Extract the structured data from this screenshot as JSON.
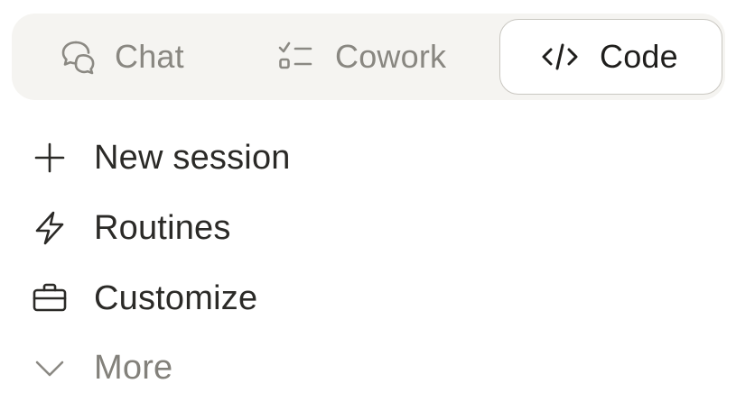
{
  "mode_switcher": {
    "tabs": [
      {
        "label": "Chat",
        "icon": "chat-bubbles-icon",
        "active": false
      },
      {
        "label": "Cowork",
        "icon": "checklist-icon",
        "active": false
      },
      {
        "label": "Code",
        "icon": "code-brackets-icon",
        "active": true
      }
    ]
  },
  "nav": {
    "items": [
      {
        "label": "New session",
        "icon": "plus-icon"
      },
      {
        "label": "Routines",
        "icon": "lightning-icon"
      },
      {
        "label": "Customize",
        "icon": "briefcase-icon"
      },
      {
        "label": "More",
        "icon": "chevron-down-icon"
      }
    ]
  },
  "colors": {
    "switcher_bg": "#f5f4f1",
    "active_tab_bg": "#ffffff",
    "active_tab_border": "#c9c7c1",
    "text_primary": "#2b2a27",
    "text_muted": "#898781"
  }
}
